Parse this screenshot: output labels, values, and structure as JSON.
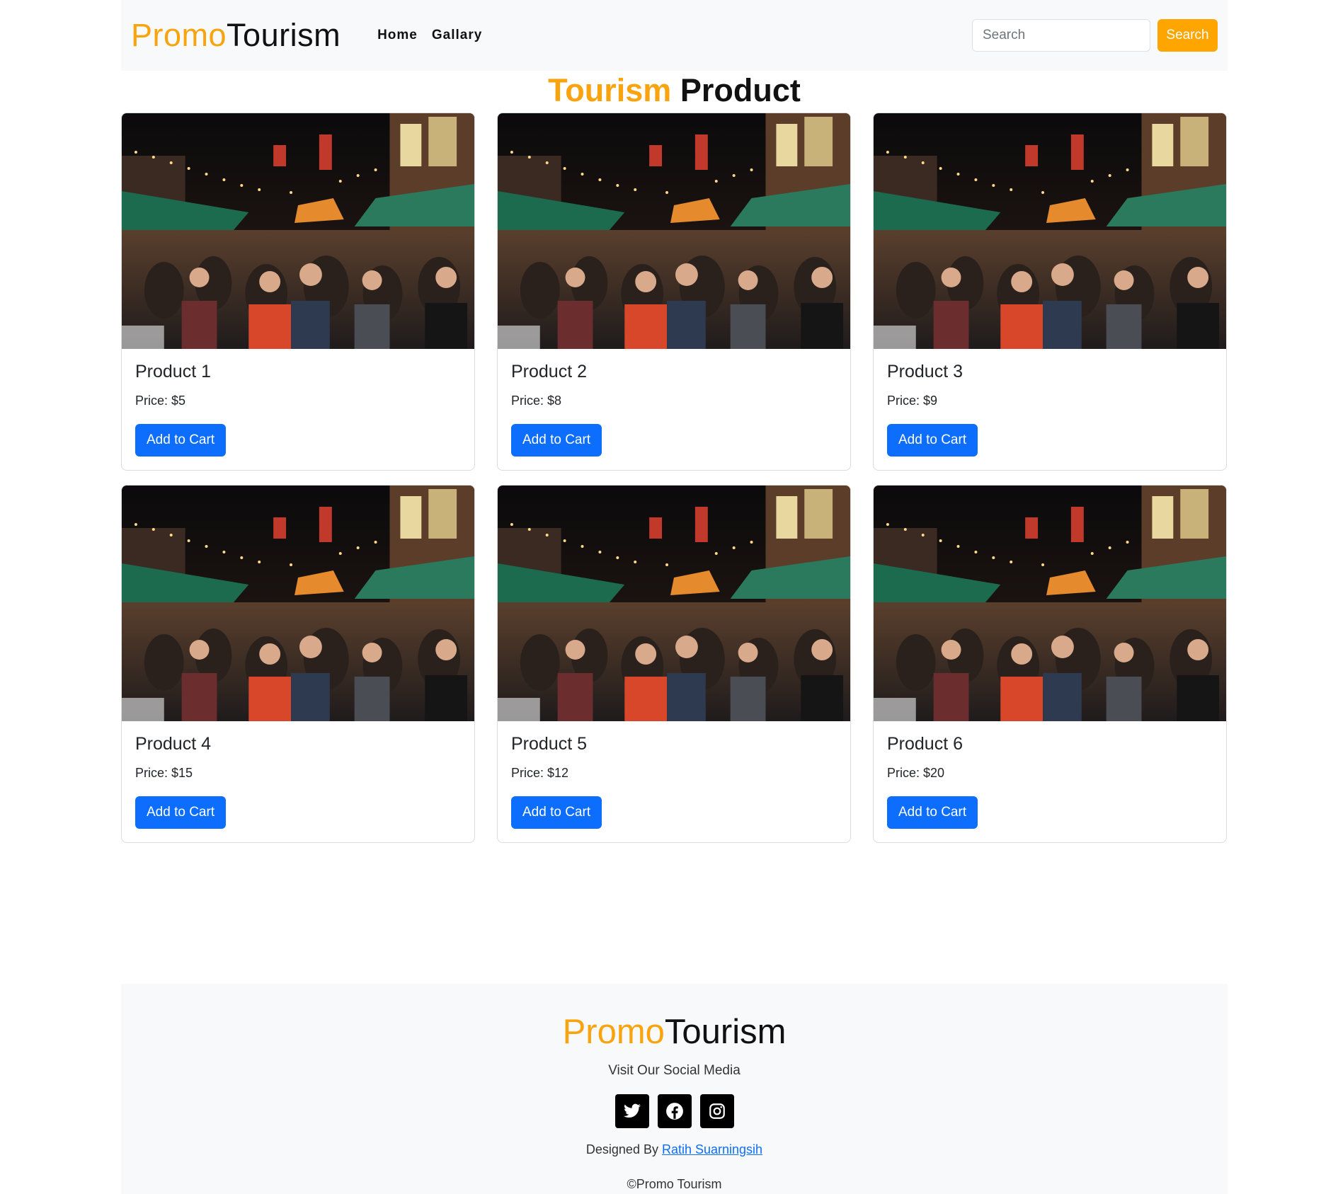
{
  "navbar": {
    "brand_accent": "Promo",
    "brand_rest": "Tourism",
    "links": [
      "Home",
      "Gallary"
    ],
    "search_placeholder": "Search",
    "search_button": "Search"
  },
  "page": {
    "title_accent": "Tourism",
    "title_rest": "Product"
  },
  "products": [
    {
      "title": "Product 1",
      "price": "Price: $5",
      "button": "Add to Cart"
    },
    {
      "title": "Product 2",
      "price": "Price: $8",
      "button": "Add to Cart"
    },
    {
      "title": "Product 3",
      "price": "Price: $9",
      "button": "Add to Cart"
    },
    {
      "title": "Product 4",
      "price": "Price: $15",
      "button": "Add to Cart"
    },
    {
      "title": "Product 5",
      "price": "Price: $12",
      "button": "Add to Cart"
    },
    {
      "title": "Product 6",
      "price": "Price: $20",
      "button": "Add to Cart"
    }
  ],
  "footer": {
    "brand_accent": "Promo",
    "brand_rest": "Tourism",
    "tagline": "Visit Our Social Media",
    "socials": [
      "twitter-icon",
      "facebook-icon",
      "instagram-icon"
    ],
    "designed_prefix": "Designed By",
    "designer": "Ratih Suarningsih",
    "copyright": "©Promo Tourism"
  },
  "colors": {
    "accent": "#f9a40f",
    "primary": "#0d6efd",
    "search_button": "#ffa500",
    "navbar_bg": "#f8f9fa"
  }
}
